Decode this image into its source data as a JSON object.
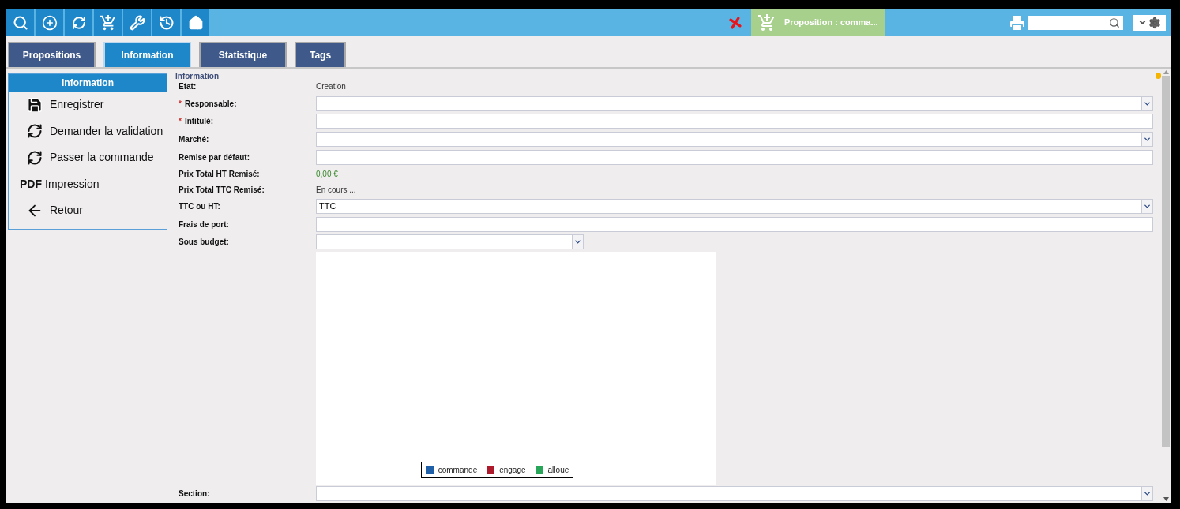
{
  "toolbar": {
    "status": "Proposition : comma..."
  },
  "tabs": [
    {
      "label": "Propositions",
      "selected": false
    },
    {
      "label": "Information",
      "selected": true
    },
    {
      "label": "Statistique",
      "selected": false
    },
    {
      "label": "Tags",
      "selected": false
    }
  ],
  "sidebar": {
    "title": "Information",
    "items": [
      {
        "label": "Enregistrer",
        "kind": "save"
      },
      {
        "label": "Demander la validation",
        "kind": "sync"
      },
      {
        "label": "Passer la commande",
        "kind": "sync"
      },
      {
        "label": "Impression",
        "kind": "badge",
        "badge": "PDF"
      },
      {
        "label": "Retour",
        "kind": "back"
      }
    ]
  },
  "form": {
    "title": "Information",
    "rows": [
      {
        "label": "Etat:",
        "kind": "text",
        "value": "Creation"
      },
      {
        "label": "Responsable:",
        "required_mark": "*",
        "kind": "select"
      },
      {
        "label": "Intitulé:",
        "required_mark": "*",
        "kind": "input"
      },
      {
        "label": "Marché:",
        "kind": "select"
      },
      {
        "label": "Remise par défaut:",
        "kind": "input"
      },
      {
        "label": "Prix Total HT Remisé:",
        "kind": "amount",
        "value": "0,00 €"
      },
      {
        "label": "Prix Total TTC Remisé:",
        "kind": "text",
        "value": "En cours ..."
      },
      {
        "label": "TTC ou HT:",
        "kind": "select",
        "value": "TTC"
      },
      {
        "label": "Frais de port:",
        "kind": "input"
      },
      {
        "label": "Sous budget:",
        "kind": "select-narrow"
      },
      {
        "kind": "chart",
        "legend": [
          {
            "name": "commande",
            "color": "#1f5fa8"
          },
          {
            "name": "engage",
            "color": "#ad1a2b"
          },
          {
            "name": "alloue",
            "color": "#27a65a"
          }
        ]
      },
      {
        "label": "Section:",
        "kind": "select"
      }
    ]
  }
}
